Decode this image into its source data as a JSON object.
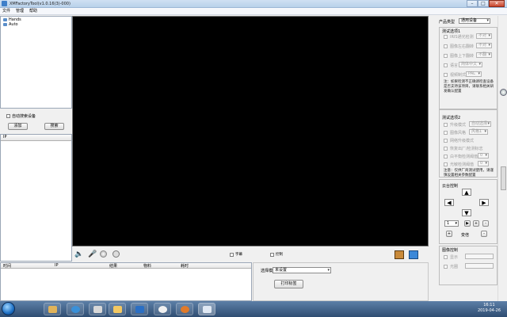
{
  "window": {
    "title": "XMFactoryTool(v1.0.16(3)-000)"
  },
  "menu": [
    "文件",
    "管理",
    "帮助"
  ],
  "tree": {
    "items": [
      "Hands",
      "Auto"
    ]
  },
  "search": {
    "auto_label": "自动搜索设备",
    "add_label": "添加",
    "search_label": "搜索"
  },
  "device_list": {
    "header_ip": "IP"
  },
  "bottom_table": {
    "headers": [
      "时间",
      "IP",
      "结果",
      "物料",
      "耗时"
    ]
  },
  "toolbar": {
    "chk1_label": "字幕",
    "chk2_label": "控制"
  },
  "print": {
    "select_label": "选择模板",
    "select_value": "未设置",
    "button_label": "打印标签"
  },
  "right": {
    "product_type_label": "产品类型",
    "product_type_value": "通用设备",
    "section1_title": "测试选项1",
    "section1_opts": [
      {
        "label": "IRIS通光检测",
        "value": "不对"
      },
      {
        "label": "图像左右翻转",
        "value": "不对"
      },
      {
        "label": "图像上下翻转",
        "value": "不翻"
      },
      {
        "label": "语言",
        "value": "简体中文"
      },
      {
        "label": "视频制式",
        "value": "PAL"
      }
    ],
    "section1_note": "注：如果检测不正确请检查设备是否支持该项目，请联系相关研发确认配置",
    "section2_title": "测试选项2",
    "section2_opts": [
      {
        "label": "升级模式",
        "value": "自动选择"
      },
      {
        "label": "图像风格",
        "value": "风格1"
      },
      {
        "label": "网络升级模式",
        "value": ""
      },
      {
        "label": "恢复出厂/检测标志",
        "value": ""
      },
      {
        "label": "白平衡检测阈值",
        "value": "0"
      },
      {
        "label": "光敏检测阈值",
        "value": "0"
      }
    ],
    "section2_note": "注意：仅供厂商测试使用，请谨慎设置相关参数配置",
    "ptz_title": "云台控制",
    "ptz_speed": "1",
    "ptz_labels": {
      "plus": "+",
      "minus": "-",
      "zoom": "变倍"
    },
    "iris_title": "图像控制",
    "iris_opts": [
      "显示",
      "光圈"
    ]
  },
  "taskbar": {
    "time": "16:11",
    "date": "2019-04-26"
  }
}
